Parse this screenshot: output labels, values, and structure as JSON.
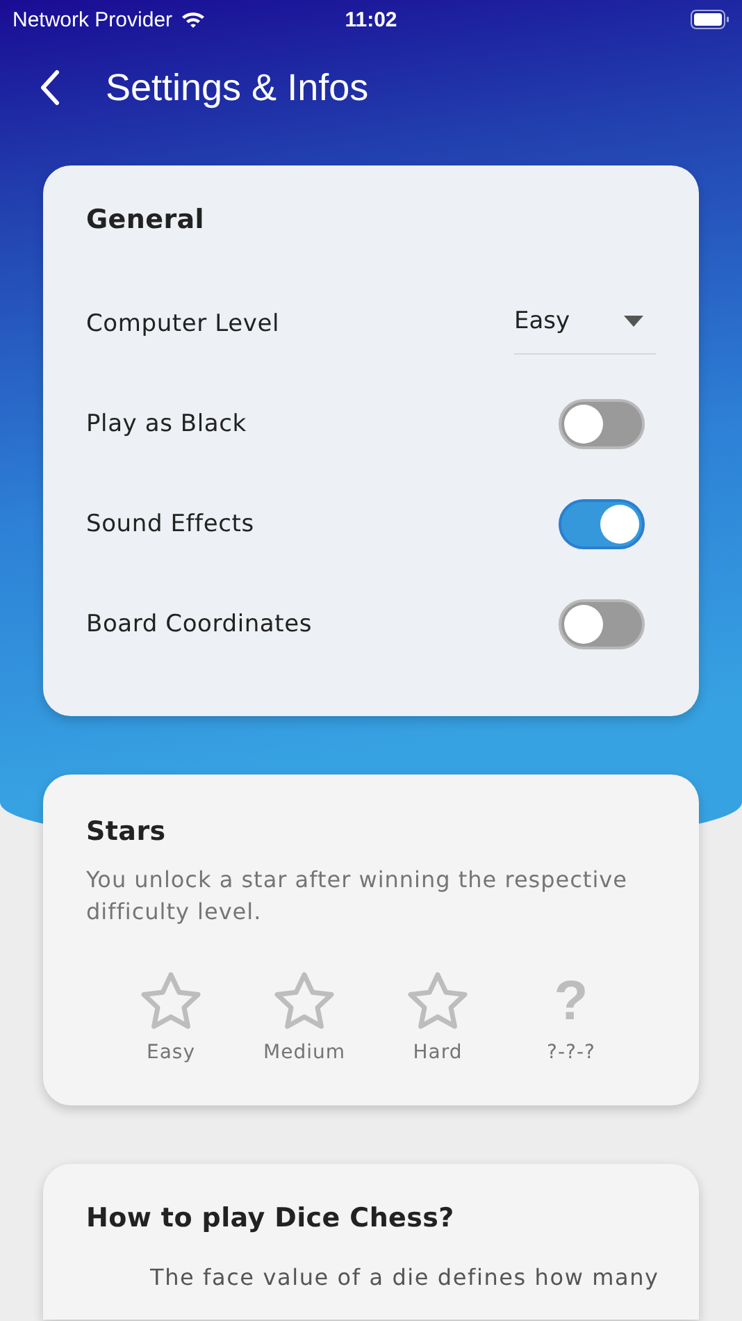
{
  "status_bar": {
    "carrier": "Network Provider",
    "time": "11:02"
  },
  "header": {
    "title": "Settings & Infos"
  },
  "general": {
    "title": "General",
    "rows": [
      {
        "kind": "dropdown",
        "label": "Computer Level",
        "value": "Easy"
      },
      {
        "kind": "toggle",
        "label": "Play as Black",
        "on": false
      },
      {
        "kind": "toggle",
        "label": "Sound Effects",
        "on": true
      },
      {
        "kind": "toggle",
        "label": "Board Coordinates",
        "on": false
      }
    ]
  },
  "stars": {
    "title": "Stars",
    "description": "You unlock a star after winning the respective difficulty level.",
    "items": [
      {
        "kind": "star",
        "label": "Easy",
        "unlocked": false
      },
      {
        "kind": "star",
        "label": "Medium",
        "unlocked": false
      },
      {
        "kind": "star",
        "label": "Hard",
        "unlocked": false
      },
      {
        "kind": "unknown",
        "symbol": "?",
        "label": "?-?-?"
      }
    ]
  },
  "how_to": {
    "title": "How to play Dice Chess?",
    "text": "The face value of a die defines how many"
  }
}
